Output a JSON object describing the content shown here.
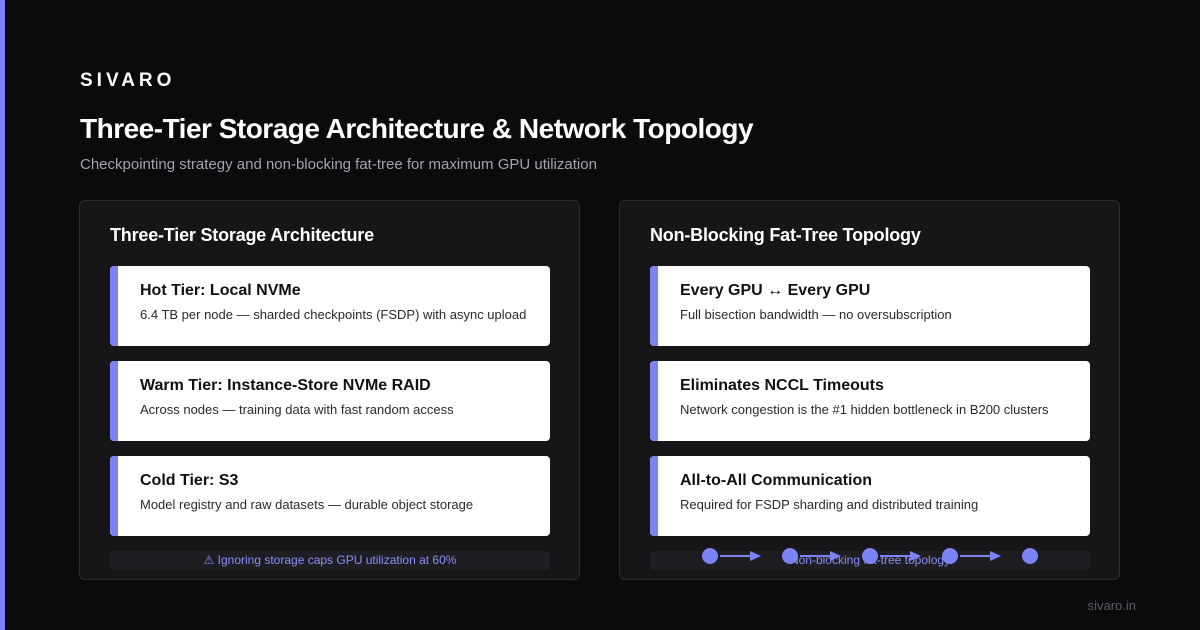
{
  "brand": "SIVARO",
  "title": "Three-Tier Storage Architecture & Network Topology",
  "subtitle": "Checkpointing strategy and non-blocking fat-tree for maximum GPU utilization",
  "storage_panel": {
    "title": "Three-Tier Storage Architecture",
    "cards": [
      {
        "title": "Hot Tier: Local NVMe",
        "desc": "6.4 TB per node — sharded checkpoints (FSDP) with async upload"
      },
      {
        "title": "Warm Tier: Instance-Store NVMe RAID",
        "desc": "Across nodes — training data with fast random access"
      },
      {
        "title": "Cold Tier: S3",
        "desc": "Model registry and raw datasets — durable object storage"
      }
    ],
    "warning": "⚠ Ignoring storage caps GPU utilization at 60%"
  },
  "network_panel": {
    "title": "Non-Blocking Fat-Tree Topology",
    "cards": [
      {
        "title": "Every GPU ↔ Every GPU",
        "desc": "Full bisection bandwidth — no oversubscription"
      },
      {
        "title": "Eliminates NCCL Timeouts",
        "desc": "Network congestion is the #1 hidden bottleneck in B200 clusters"
      },
      {
        "title": "All-to-All Communication",
        "desc": "Required for FSDP sharding and distributed training"
      }
    ],
    "topology_label": "Non-blocking fat-tree topology"
  },
  "site": "sivaro.in",
  "colors": {
    "accent": "#7c83f5",
    "background": "#0b0b0d",
    "panel": "#161618",
    "card": "#ffffff"
  }
}
